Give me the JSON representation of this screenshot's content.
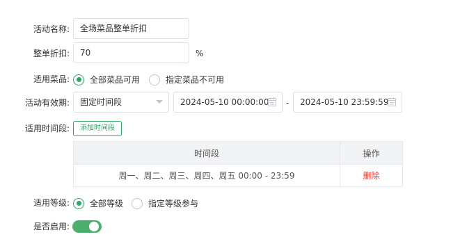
{
  "form": {
    "activity_name": {
      "label": "活动名称:",
      "value": "全场菜品整单折扣"
    },
    "discount": {
      "label": "整单折扣:",
      "value": "70",
      "unit": "%"
    },
    "dishes": {
      "label": "适用菜品:",
      "options": [
        {
          "label": "全部菜品可用",
          "checked": true
        },
        {
          "label": "指定菜品不可用",
          "checked": false
        }
      ]
    },
    "validity": {
      "label": "活动有效期:",
      "mode": "固定时间段",
      "start": "2024-05-10 00:00:00",
      "separator": "-",
      "end": "2024-05-10 23:59:59"
    },
    "time_slots": {
      "label": "适用时间段:",
      "add_button": "添加时间段",
      "table": {
        "headers": [
          "时间段",
          "操作"
        ],
        "rows": [
          {
            "period": "周一、周二、周三、周四、周五 00:00 - 23:59",
            "action": "删除"
          }
        ]
      }
    },
    "levels": {
      "label": "适用等级:",
      "options": [
        {
          "label": "全部等级",
          "checked": true
        },
        {
          "label": "指定等级参与",
          "checked": false
        }
      ]
    },
    "enabled": {
      "label": "是否启用:",
      "on": true
    }
  },
  "colors": {
    "accent": "#2ea768",
    "switch_on": "#4caf6b",
    "danger": "#f04135",
    "border": "#dcdfe6"
  }
}
